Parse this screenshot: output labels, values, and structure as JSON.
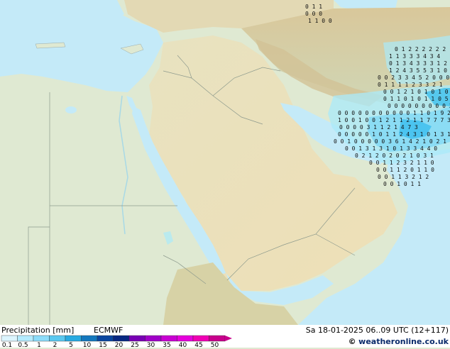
{
  "footer": {
    "title": "Precipitation [mm]",
    "model": "ECMWF",
    "valid": "Sa 18-01-2025 06..09 UTC (12+117)",
    "credit_copy": "©",
    "credit_site": "weatheronline.co.uk"
  },
  "legend": {
    "labels": [
      "0.1",
      "0.5",
      "1",
      "2",
      "5",
      "10",
      "15",
      "20",
      "25",
      "30",
      "35",
      "40",
      "45",
      "50"
    ],
    "colors": [
      "#dcf5ff",
      "#b4ebff",
      "#8cdcfa",
      "#5ac8f0",
      "#28aae1",
      "#1478be",
      "#0a46a0",
      "#082882",
      "#7800b4",
      "#a000c8",
      "#c800d2",
      "#e600dc",
      "#f000b4",
      "#c8008c"
    ]
  },
  "map": {
    "sea_color": "#c4eaf8",
    "land_color": "#dfe9d2",
    "desert_color": "#eae0bc",
    "mountain_color": "#d6c9a2",
    "rain_light_color": "#9fe6fa",
    "rain_heavy_color": "#3fc0ee",
    "numbers": [
      {
        "row": 0,
        "text": "0 1 1"
      },
      {
        "row": 1,
        "text": "0 0 0"
      },
      {
        "row": 2,
        "text": "1 1 0 0"
      },
      {
        "row": 3,
        "text": "0 1 2 2 2 2 2 2"
      },
      {
        "row": 4,
        "text": "1 1 3 3 3 4 3 4"
      },
      {
        "row": 5,
        "text": "0 1 3 4 3 3 3 1 2"
      },
      {
        "row": 6,
        "text": "1 2 4 3 5 5 3 1 0"
      },
      {
        "row": 7,
        "text": "0 0 2 3 3 4 5 2 0 0 0"
      },
      {
        "row": 8,
        "text": "0 1 1 1 1 2 3 3 2 1"
      },
      {
        "row": 9,
        "text": "0 0 1 2 1 0 1 0 1 0 2 2 2"
      },
      {
        "row": 10,
        "text": "0 1 1 0 1 0 1 1 0 5 1"
      },
      {
        "row": 11,
        "text": "0 0 0 0 0 0 0 0 0 3 1 1 1"
      },
      {
        "row": 12,
        "text": "0 0 0 0 0 0 0 0 0 0 0 1 1 0 1 9 2 0 0 2 2"
      },
      {
        "row": 13,
        "text": "1 0 0 1 0 0 1 2 1 1 2 1 1 7 7 7 3 1"
      },
      {
        "row": 14,
        "text": "0 0 0 0 3 1 1 2 1 4 7 3"
      },
      {
        "row": 15,
        "text": "0 0 0 0 0 1 0 1 1 2 4 3 1 0 1 3 1"
      },
      {
        "row": 16,
        "text": "0 0 1 0 0 0 0 0 3 6 1 4 2 1 0 2 1 0"
      },
      {
        "row": 17,
        "text": "0 0 1 3 1 3 1 0 1 3 3 4 4 0"
      },
      {
        "row": 18,
        "text": "0 2 1 2 0 2 0 2 1 0 3 1"
      },
      {
        "row": 19,
        "text": "0 0 1 1 2 3 2 1 1 0"
      },
      {
        "row": 20,
        "text": "0 0 1 1 2 0 1 1 0"
      },
      {
        "row": 21,
        "text": "0 0 1 1 3 2 1 2"
      },
      {
        "row": 22,
        "text": "0 0 1 0 1 1"
      }
    ]
  }
}
